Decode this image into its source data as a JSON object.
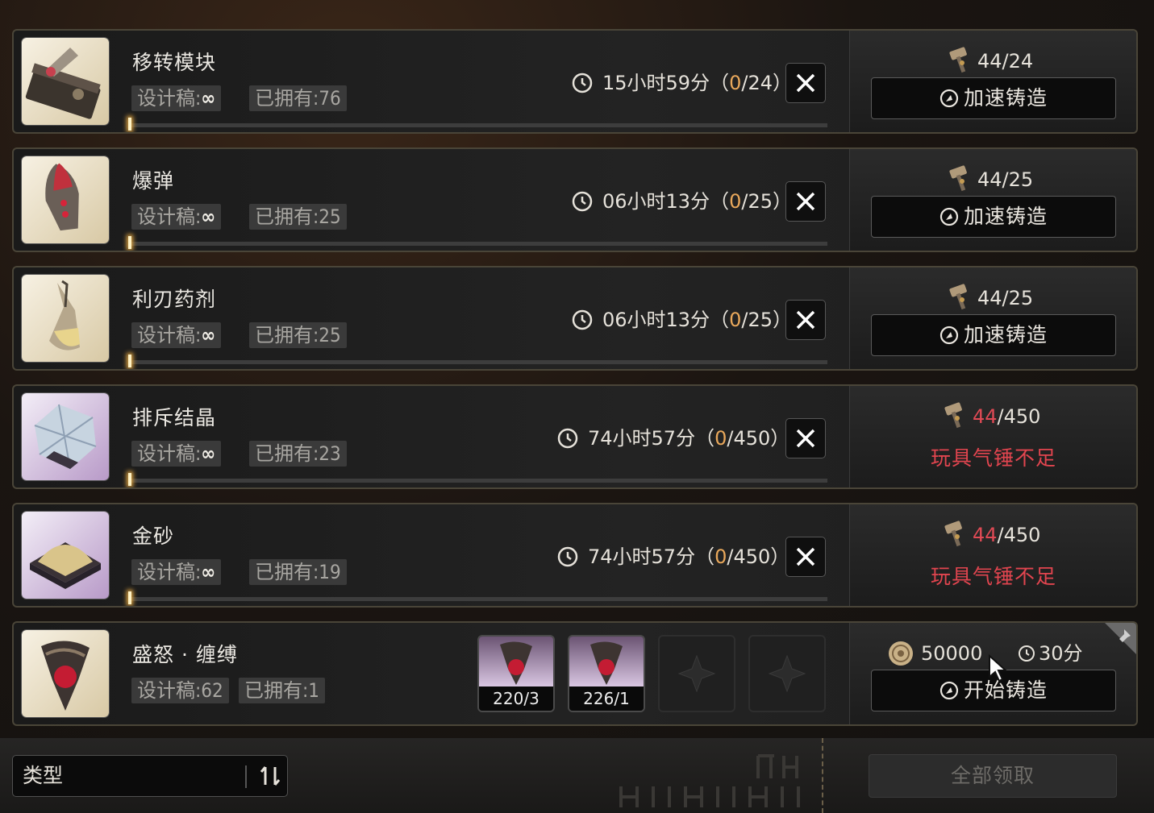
{
  "rows": [
    {
      "name": "移转模块",
      "design": "设计稿:",
      "design_value": "∞",
      "owned": "已拥有:76",
      "timer_main": "15小时59分（",
      "timer_zero": "0",
      "timer_rest": "/24）",
      "hammer_have": "44",
      "hammer_need": "/24",
      "hammer_insufficient": false,
      "action_label": "加速铸造",
      "progress": 0,
      "thumb_style": "gold",
      "icon": "module-icon"
    },
    {
      "name": "爆弹",
      "design": "设计稿:",
      "design_value": "∞",
      "owned": "已拥有:25",
      "timer_main": "06小时13分（",
      "timer_zero": "0",
      "timer_rest": "/25）",
      "hammer_have": "44",
      "hammer_need": "/25",
      "hammer_insufficient": false,
      "action_label": "加速铸造",
      "progress": 0,
      "thumb_style": "gold",
      "icon": "bomb-icon"
    },
    {
      "name": "利刃药剂",
      "design": "设计稿:",
      "design_value": "∞",
      "owned": "已拥有:25",
      "timer_main": "06小时13分（",
      "timer_zero": "0",
      "timer_rest": "/25）",
      "hammer_have": "44",
      "hammer_need": "/25",
      "hammer_insufficient": false,
      "action_label": "加速铸造",
      "progress": 0,
      "thumb_style": "gold",
      "icon": "potion-icon"
    },
    {
      "name": "排斥结晶",
      "design": "设计稿:",
      "design_value": "∞",
      "owned": "已拥有:23",
      "timer_main": "74小时57分（",
      "timer_zero": "0",
      "timer_rest": "/450）",
      "hammer_have": "44",
      "hammer_need": "/450",
      "hammer_insufficient": true,
      "warning": "玩具气锤不足",
      "progress": 0,
      "thumb_style": "purple",
      "icon": "crystal-icon"
    },
    {
      "name": "金砂",
      "design": "设计稿:",
      "design_value": "∞",
      "owned": "已拥有:19",
      "timer_main": "74小时57分（",
      "timer_zero": "0",
      "timer_rest": "/450）",
      "hammer_have": "44",
      "hammer_need": "/450",
      "hammer_insufficient": true,
      "warning": "玩具气锤不足",
      "progress": 0,
      "thumb_style": "purple",
      "icon": "gold-sand-icon"
    }
  ],
  "craft_row": {
    "name": "盛怒 · 缠缚",
    "design": "设计稿:62",
    "owned": "已拥有:1",
    "materials": [
      {
        "count": "220/3",
        "icon": "rage-bind-material-icon"
      },
      {
        "count": "226/1",
        "icon": "rage-bind-material-icon"
      },
      {
        "empty": true
      },
      {
        "empty": true
      }
    ],
    "coin_cost": "50000",
    "time": "30分",
    "action_label": "开始铸造",
    "icon": "rage-bind-icon"
  },
  "footer": {
    "sort_label": "类型",
    "claim_all_label": "全部领取"
  },
  "colors": {
    "accent_orange": "#e9a85b",
    "warning_red": "#e2454f",
    "panel_border": "#4a4538"
  }
}
